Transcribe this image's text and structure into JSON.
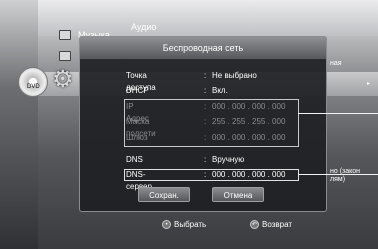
{
  "background_menu": {
    "music_label": "Музыка",
    "audio_label": "Аудио",
    "disc_label": "DVD",
    "right_text_1": "ная",
    "right_arrow": "▸",
    "right_text_2": "но (закон\nлям)"
  },
  "dialog": {
    "title": "Беспроводная сеть",
    "rows": [
      {
        "label": "Точка доступа",
        "value": "Не выбрано",
        "enabled": true
      },
      {
        "label": "DHCP",
        "value": "Вкл.",
        "enabled": true
      },
      {
        "label": "IP Адрес",
        "value": "000 . 000 . 000 . 000",
        "enabled": false
      },
      {
        "label": "Маска подсети",
        "value": "255 . 255 . 255 . 000",
        "enabled": false
      },
      {
        "label": "Шлюз",
        "value": "000 . 000 . 000 . 000",
        "enabled": false
      },
      {
        "label": "DNS",
        "value": "Вручную",
        "enabled": true
      },
      {
        "label": "DNS-сервер",
        "value": "000 . 000 . 000 . 000",
        "enabled": true
      }
    ],
    "colon": ":",
    "save_label": "Сохран.",
    "cancel_label": "Отмена"
  },
  "hints": {
    "select_label": "Выбрать",
    "back_label": "Возврат"
  }
}
